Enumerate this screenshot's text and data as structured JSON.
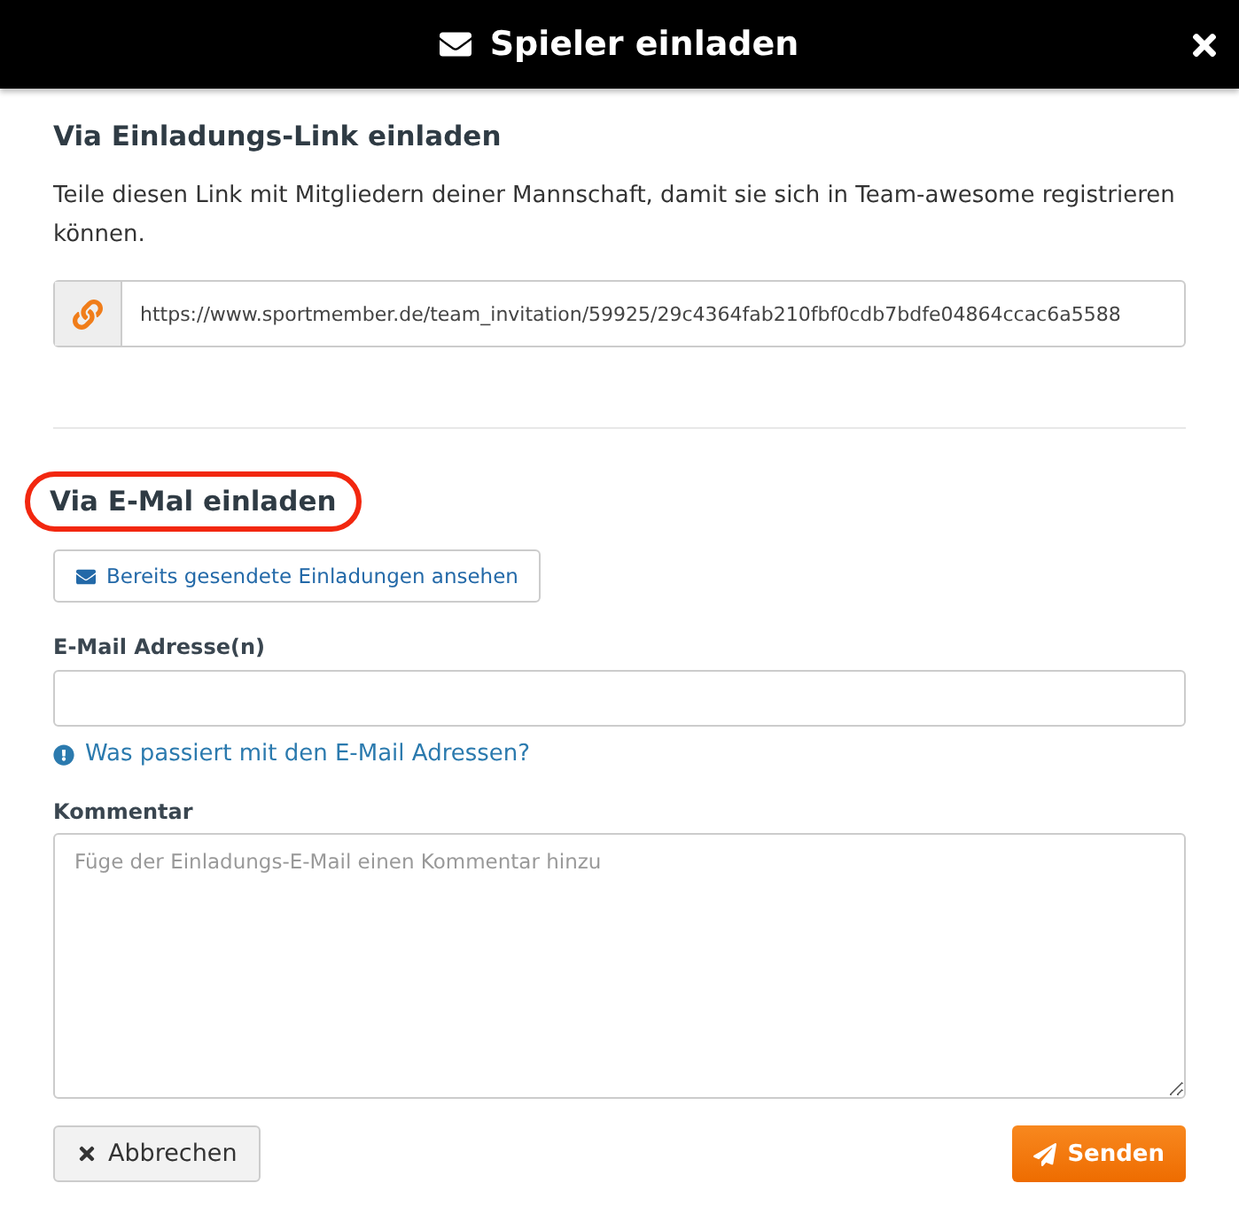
{
  "dialog": {
    "title": "Spieler einladen"
  },
  "link_section": {
    "heading": "Via Einladungs-Link einladen",
    "description": "Teile diesen Link mit Mitgliedern deiner Mannschaft, damit sie sich in Team-awesome registrieren können.",
    "link": "https://www.sportmember.de/team_invitation/59925/29c4364fab210fbf0cdb7bdfe04864ccac6a5588"
  },
  "email_section": {
    "heading": "Via E-Mal einladen",
    "highlighted": true,
    "sent_button": "Bereits gesendete Einladungen ansehen",
    "email_label": "E-Mail Adresse(n)",
    "help_link": "Was passiert mit den E-Mail Adressen?",
    "comment_label": "Kommentar",
    "comment_placeholder": "Füge der Einladungs-E-Mail einen Kommentar hinzu"
  },
  "buttons": [
    {
      "label": "Abbrechen",
      "kind": "cancel"
    },
    {
      "label": "Senden",
      "kind": "primary"
    }
  ]
}
